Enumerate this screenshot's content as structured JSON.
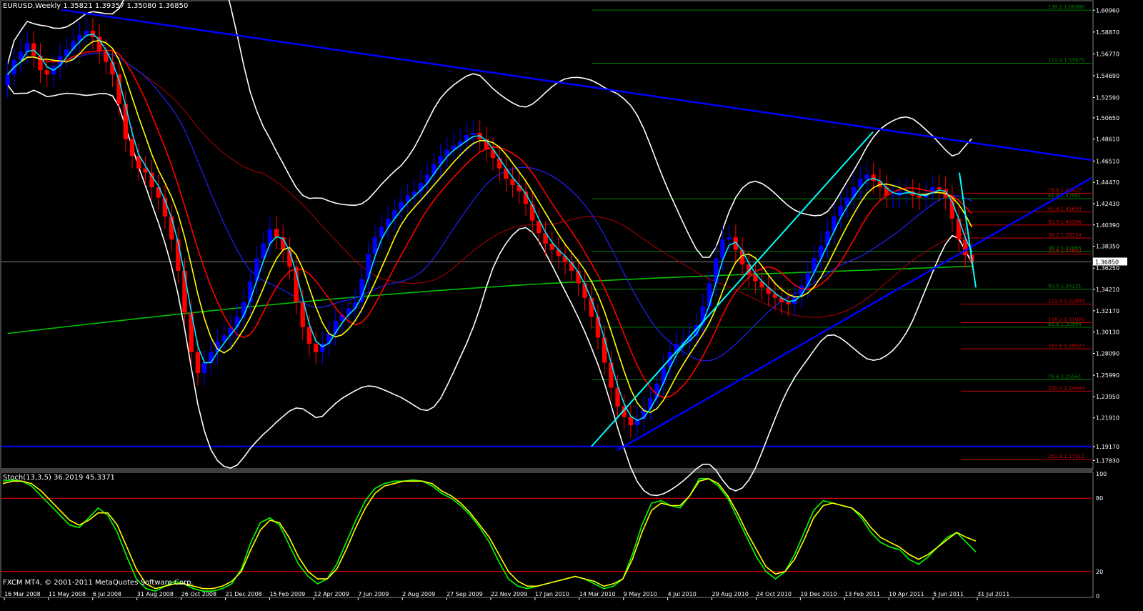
{
  "header": {
    "main_title": "EURUSD,Weekly  1.35821 1.39357 1.35080 1.36850",
    "sub_title": "Stoch(13,3,5) 36.2019 45.3371",
    "copyright": "FXCM MT4, © 2001-2011 MetaQuotes Software Corp."
  },
  "colors": {
    "background": "#000000",
    "bull": "#0000ff",
    "bear": "#ff0000",
    "cyan_ma": "#00e5ff",
    "yellow_ma": "#ffff00",
    "red_ma": "#ff0000",
    "blue_ma": "#2020ff",
    "green_ma": "#00c000",
    "darkred_ma": "#b00000",
    "bands": "#ffffff",
    "trendline": "#0000ff",
    "trendline_cyan": "#00ffff",
    "fib_green": "#008000",
    "fib_red": "#cc0000",
    "stoch_main": "#00ff00",
    "stoch_signal": "#ffff00",
    "stoch_level": "#ff0000",
    "axis_text": "#ffffff"
  },
  "chart_data": [
    {
      "type": "line",
      "title": "EURUSD,Weekly",
      "ohlc_last": {
        "open": 1.35821,
        "high": 1.39357,
        "low": 1.3508,
        "close": 1.3685
      },
      "current_price_label": "1.36850",
      "ylim": [
        1.171,
        1.618
      ],
      "y_ticks": [
        "1.60960",
        "1.58870",
        "1.56770",
        "1.54690",
        "1.52590",
        "1.50650",
        "1.48610",
        "1.46510",
        "1.44470",
        "1.42430",
        "1.40390",
        "1.38350",
        "1.36250",
        "1.34210",
        "1.32170",
        "1.30130",
        "1.28090",
        "1.25990",
        "1.23950",
        "1.21910",
        "1.19170",
        "1.17830"
      ],
      "x_ticks": [
        "16 Mar 2008",
        "11 May 2008",
        "6 Jul 2008",
        "31 Aug 2008",
        "26 Oct 2008",
        "21 Dec 2008",
        "15 Feb 2009",
        "12 Apr 2009",
        "7 Jun 2009",
        "2 Aug 2009",
        "27 Sep 2009",
        "22 Nov 2009",
        "17 Jan 2010",
        "14 Mar 2010",
        "9 May 2010",
        "4 Jul 2010",
        "29 Aug 2010",
        "24 Oct 2010",
        "19 Dec 2010",
        "13 Feb 2011",
        "10 Apr 2011",
        "5 Jun 2011",
        "31 Jul 2011"
      ],
      "close_path": [
        1.548,
        1.562,
        1.57,
        1.578,
        1.566,
        1.552,
        1.548,
        1.556,
        1.566,
        1.572,
        1.58,
        1.586,
        1.59,
        1.584,
        1.57,
        1.56,
        1.548,
        1.52,
        1.486,
        1.47,
        1.458,
        1.454,
        1.44,
        1.43,
        1.412,
        1.39,
        1.36,
        1.32,
        1.282,
        1.262,
        1.272,
        1.282,
        1.292,
        1.298,
        1.306,
        1.316,
        1.33,
        1.35,
        1.372,
        1.386,
        1.4,
        1.392,
        1.38,
        1.364,
        1.33,
        1.306,
        1.29,
        1.282,
        1.29,
        1.3,
        1.312,
        1.318,
        1.324,
        1.33,
        1.352,
        1.376,
        1.392,
        1.402,
        1.41,
        1.418,
        1.426,
        1.432,
        1.436,
        1.444,
        1.452,
        1.462,
        1.47,
        1.476,
        1.48,
        1.484,
        1.49,
        1.492,
        1.486,
        1.476,
        1.468,
        1.458,
        1.448,
        1.442,
        1.436,
        1.424,
        1.408,
        1.396,
        1.386,
        1.38,
        1.374,
        1.368,
        1.36,
        1.348,
        1.334,
        1.316,
        1.296,
        1.272,
        1.248,
        1.23,
        1.22,
        1.212,
        1.218,
        1.228,
        1.238,
        1.252,
        1.268,
        1.282,
        1.29,
        1.292,
        1.298,
        1.308,
        1.326,
        1.348,
        1.372,
        1.39,
        1.392,
        1.38,
        1.366,
        1.356,
        1.35,
        1.344,
        1.338,
        1.334,
        1.33,
        1.328,
        1.336,
        1.346,
        1.358,
        1.372,
        1.384,
        1.398,
        1.412,
        1.422,
        1.43,
        1.44,
        1.448,
        1.452,
        1.446,
        1.44,
        1.432,
        1.432,
        1.436,
        1.436,
        1.432,
        1.43,
        1.434,
        1.44,
        1.438,
        1.43,
        1.41,
        1.39,
        1.375,
        1.3685
      ],
      "indicators": {
        "bollinger_upper_note": "white",
        "bollinger_lower_note": "white"
      },
      "horizontal_levels": [
        1.1917
      ],
      "fib_levels": [
        {
          "pct": "138.2",
          "price": "1.60966",
          "color": "green"
        },
        {
          "pct": "121.4",
          "price": "1.55875",
          "color": "green"
        },
        {
          "pct": "78.6",
          "price": "1.43427",
          "color": "red"
        },
        {
          "pct": "61.8",
          "price": "1.42901",
          "color": "green"
        },
        {
          "pct": "61.8",
          "price": "1.41639",
          "color": "red"
        },
        {
          "pct": "50.0",
          "price": "1.40386",
          "color": "red"
        },
        {
          "pct": "38.2",
          "price": "1.39134",
          "color": "red"
        },
        {
          "pct": "38.2",
          "price": "1.37865",
          "color": "green"
        },
        {
          "pct": "23.6",
          "price": "1.37602",
          "color": "red"
        },
        {
          "pct": "50.0",
          "price": "1.34231",
          "color": "green"
        },
        {
          "pct": "121.4",
          "price": "1.32809",
          "color": "red"
        },
        {
          "pct": "138.2",
          "price": "1.31026",
          "color": "red"
        },
        {
          "pct": "61.8",
          "price": "1.30594",
          "color": "green"
        },
        {
          "pct": "161.8",
          "price": "1.28522",
          "color": "red"
        },
        {
          "pct": "78.6",
          "price": "1.25561",
          "color": "green"
        },
        {
          "pct": "200.0",
          "price": "1.24469",
          "color": "red"
        },
        {
          "pct": "261.8",
          "price": "1.17911",
          "color": "red"
        }
      ]
    },
    {
      "type": "line",
      "title": "Stoch(13,3,5)",
      "main_value": 36.2019,
      "signal_value": 45.3371,
      "ylim": [
        0,
        100
      ],
      "levels": [
        80,
        20
      ],
      "y_ticks": [
        "100",
        "80",
        "20",
        "0"
      ],
      "series": [
        {
          "values": [
            94,
            95,
            94,
            90,
            82,
            74,
            66,
            58,
            56,
            64,
            72,
            66,
            52,
            32,
            14,
            6,
            4,
            8,
            12,
            10,
            6,
            4,
            4,
            6,
            10,
            22,
            44,
            60,
            64,
            58,
            42,
            26,
            16,
            10,
            14,
            26,
            44,
            62,
            78,
            88,
            92,
            94,
            94,
            95,
            94,
            90,
            84,
            80,
            74,
            66,
            56,
            44,
            28,
            14,
            8,
            6,
            8,
            10,
            12,
            14,
            16,
            14,
            10,
            6,
            8,
            14,
            34,
            58,
            76,
            78,
            74,
            72,
            82,
            96,
            96,
            90,
            80,
            64,
            48,
            32,
            20,
            14,
            20,
            34,
            52,
            70,
            78,
            76,
            74,
            72,
            64,
            52,
            44,
            40,
            38,
            30,
            26,
            32,
            40,
            48,
            52,
            44,
            36
          ]
        },
        {
          "values": [
            92,
            94,
            94,
            92,
            86,
            78,
            70,
            62,
            58,
            62,
            68,
            68,
            58,
            40,
            22,
            10,
            6,
            8,
            10,
            10,
            8,
            6,
            6,
            8,
            12,
            20,
            38,
            54,
            62,
            60,
            48,
            32,
            20,
            14,
            14,
            22,
            38,
            56,
            72,
            84,
            90,
            92,
            94,
            94,
            94,
            92,
            86,
            82,
            76,
            68,
            58,
            48,
            34,
            20,
            12,
            8,
            8,
            10,
            12,
            14,
            16,
            14,
            12,
            8,
            10,
            14,
            30,
            52,
            70,
            76,
            74,
            74,
            82,
            94,
            96,
            92,
            82,
            68,
            52,
            38,
            24,
            18,
            20,
            30,
            46,
            64,
            74,
            76,
            74,
            72,
            66,
            56,
            48,
            44,
            40,
            34,
            30,
            34,
            40,
            46,
            52,
            48,
            45
          ]
        }
      ]
    }
  ]
}
